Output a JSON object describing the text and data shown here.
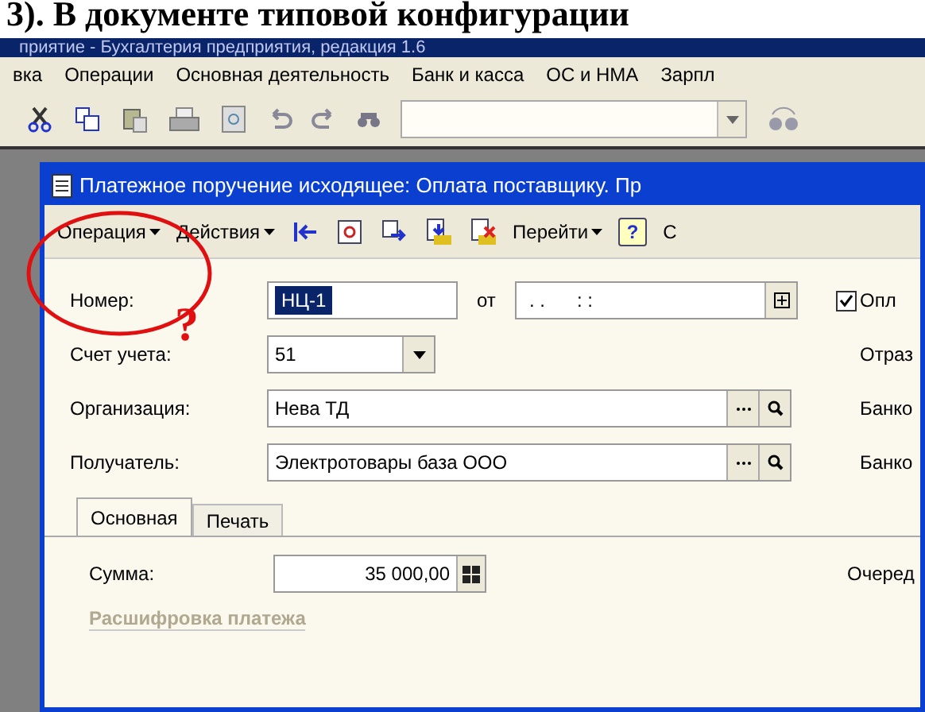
{
  "heading": "3). В документе типовой конфигурации",
  "app": {
    "title": "приятие - Бухгалтерия предприятия, редакция 1.6",
    "menu": [
      "вка",
      "Операции",
      "Основная деятельность",
      "Банк и касса",
      "ОС и НМА",
      "Зарпл"
    ]
  },
  "document": {
    "title": "Платежное поручение исходящее: Оплата поставщику. Пр",
    "toolbar": [
      {
        "kind": "menu",
        "label": "Операция"
      },
      {
        "kind": "menu",
        "label": "Действия"
      },
      {
        "kind": "icon"
      },
      {
        "kind": "icon"
      },
      {
        "kind": "icon"
      },
      {
        "kind": "icon"
      },
      {
        "kind": "icon"
      },
      {
        "kind": "menu",
        "label": "Перейти"
      },
      {
        "kind": "help",
        "label": "?"
      },
      {
        "kind": "text",
        "label": "С"
      }
    ],
    "fields": [
      {
        "label": "Номер:",
        "value": "НЦ-1",
        "kind": "number",
        "date_label": "от",
        "date": ". .      : :"
      },
      {
        "label": "Счет учета:",
        "value": "51",
        "kind": "select"
      },
      {
        "label": "Организация:",
        "value": "Нева ТД",
        "kind": "ref"
      },
      {
        "label": "Получатель:",
        "value": "Электротовары база ООО",
        "kind": "ref"
      }
    ],
    "right_labels": [
      "Опл",
      "Отраз",
      "Банко",
      "Банко"
    ],
    "paid": {
      "checked": true
    },
    "tabs": [
      {
        "label": "Основная",
        "selected": true
      },
      {
        "label": "Печать",
        "selected": false
      }
    ],
    "amount": {
      "label": "Сумма:",
      "value": "35 000,00"
    },
    "queue_label": "Очеред",
    "section": "Расшифровка платежа"
  },
  "annotation": {
    "mark": "?"
  }
}
